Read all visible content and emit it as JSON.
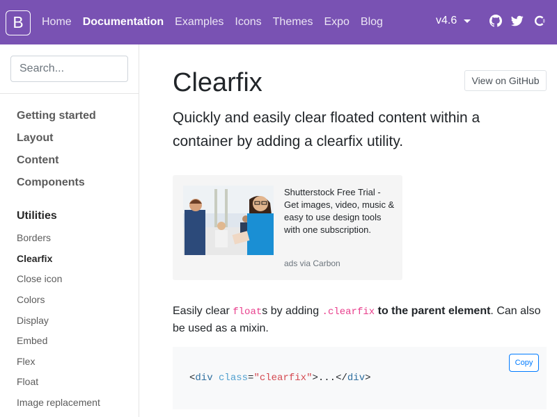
{
  "navbar": {
    "brand_letter": "B",
    "links": [
      {
        "label": "Home",
        "active": false
      },
      {
        "label": "Documentation",
        "active": true
      },
      {
        "label": "Examples",
        "active": false
      },
      {
        "label": "Icons",
        "active": false
      },
      {
        "label": "Themes",
        "active": false
      },
      {
        "label": "Expo",
        "active": false
      },
      {
        "label": "Blog",
        "active": false
      }
    ],
    "version": "v4.6",
    "icons": [
      "github-icon",
      "twitter-icon",
      "opencollective-icon"
    ],
    "colors": {
      "background": "#7952b3",
      "text": "#ffffff"
    }
  },
  "sidebar": {
    "search_placeholder": "Search...",
    "groups": [
      "Getting started",
      "Layout",
      "Content",
      "Components",
      "Utilities"
    ],
    "utilities_items": [
      "Borders",
      "Clearfix",
      "Close icon",
      "Colors",
      "Display",
      "Embed",
      "Flex",
      "Float",
      "Image replacement"
    ],
    "active_group": "Utilities",
    "active_item": "Clearfix"
  },
  "main": {
    "title": "Clearfix",
    "github_button": "View on GitHub",
    "lead": "Quickly and easily clear floated content within a container by adding a clearfix utility.",
    "ad": {
      "text": "Shutterstock Free Trial - Get images, video, music & easy to use design tools with one subscription.",
      "powered_by": "ads via Carbon"
    },
    "paragraph": {
      "p1": "Easily clear ",
      "code1": "float",
      "p2": "s by adding ",
      "code2": ".clearfix",
      "strong": " to the parent element",
      "p3": ". Can also be used as a mixin."
    },
    "code": {
      "copy_label": "Copy",
      "lt1": "<",
      "tag1": "div",
      "attr": "class",
      "eq": "=",
      "str": "\"clearfix\"",
      "mid": ">...</",
      "tag2": "div",
      "gt": ">"
    }
  }
}
